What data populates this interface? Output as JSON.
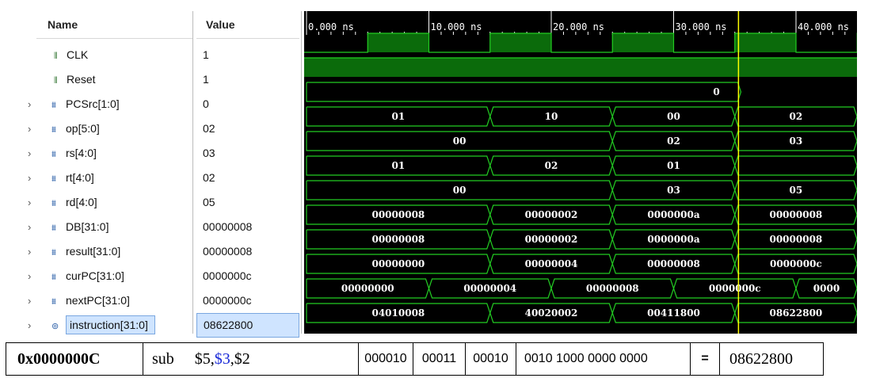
{
  "columns": {
    "name": "Name",
    "value": "Value"
  },
  "time_ticks": [
    "0.000 ns",
    "10.000 ns",
    "20.000 ns",
    "30.000 ns",
    "40.000 ns"
  ],
  "signals": [
    {
      "name": "CLK",
      "value": "1",
      "kind": "bit",
      "icon": "clock-signal-icon",
      "expandable": false
    },
    {
      "name": "Reset",
      "value": "1",
      "kind": "bit",
      "icon": "bit-signal-icon",
      "expandable": false
    },
    {
      "name": "PCSrc[1:0]",
      "value": "0",
      "kind": "bus",
      "icon": "bus-signal-icon",
      "expandable": true,
      "segments": [
        {
          "label": "",
          "t0": 0,
          "t1": 35.5
        }
      ],
      "note_label": "0"
    },
    {
      "name": "op[5:0]",
      "value": "02",
      "kind": "bus",
      "icon": "bus-signal-icon",
      "expandable": true,
      "segments": [
        {
          "label": "01",
          "t0": 0,
          "t1": 15
        },
        {
          "label": "10",
          "t0": 15,
          "t1": 25
        },
        {
          "label": "00",
          "t0": 25,
          "t1": 35
        },
        {
          "label": "02",
          "t0": 35,
          "t1": 45
        }
      ]
    },
    {
      "name": "rs[4:0]",
      "value": "03",
      "kind": "bus",
      "icon": "bus-signal-icon",
      "expandable": true,
      "segments": [
        {
          "label": "00",
          "t0": 0,
          "t1": 25
        },
        {
          "label": "02",
          "t0": 25,
          "t1": 35
        },
        {
          "label": "03",
          "t0": 35,
          "t1": 45
        }
      ]
    },
    {
      "name": "rt[4:0]",
      "value": "02",
      "kind": "bus",
      "icon": "bus-signal-icon",
      "expandable": true,
      "segments": [
        {
          "label": "01",
          "t0": 0,
          "t1": 15
        },
        {
          "label": "02",
          "t0": 15,
          "t1": 25
        },
        {
          "label": "01",
          "t0": 25,
          "t1": 35
        },
        {
          "label": "",
          "t0": 35,
          "t1": 45
        }
      ]
    },
    {
      "name": "rd[4:0]",
      "value": "05",
      "kind": "bus",
      "icon": "bus-signal-icon",
      "expandable": true,
      "segments": [
        {
          "label": "00",
          "t0": 0,
          "t1": 25
        },
        {
          "label": "03",
          "t0": 25,
          "t1": 35
        },
        {
          "label": "05",
          "t0": 35,
          "t1": 45
        }
      ]
    },
    {
      "name": "DB[31:0]",
      "value": "00000008",
      "kind": "bus",
      "icon": "bus-signal-icon",
      "expandable": true,
      "segments": [
        {
          "label": "00000008",
          "t0": 0,
          "t1": 15
        },
        {
          "label": "00000002",
          "t0": 15,
          "t1": 25
        },
        {
          "label": "0000000a",
          "t0": 25,
          "t1": 35
        },
        {
          "label": "00000008",
          "t0": 35,
          "t1": 45
        }
      ]
    },
    {
      "name": "result[31:0]",
      "value": "00000008",
      "kind": "bus",
      "icon": "bus-signal-icon",
      "expandable": true,
      "segments": [
        {
          "label": "00000008",
          "t0": 0,
          "t1": 15
        },
        {
          "label": "00000002",
          "t0": 15,
          "t1": 25
        },
        {
          "label": "0000000a",
          "t0": 25,
          "t1": 35
        },
        {
          "label": "00000008",
          "t0": 35,
          "t1": 45
        }
      ]
    },
    {
      "name": "curPC[31:0]",
      "value": "0000000c",
      "kind": "bus",
      "icon": "bus-signal-icon",
      "expandable": true,
      "segments": [
        {
          "label": "00000000",
          "t0": 0,
          "t1": 15
        },
        {
          "label": "00000004",
          "t0": 15,
          "t1": 25
        },
        {
          "label": "00000008",
          "t0": 25,
          "t1": 35
        },
        {
          "label": "0000000c",
          "t0": 35,
          "t1": 45
        }
      ]
    },
    {
      "name": "nextPC[31:0]",
      "value": "0000000c",
      "kind": "bus",
      "icon": "bus-signal-icon",
      "expandable": true,
      "segments": [
        {
          "label": "00000000",
          "t0": 0,
          "t1": 10
        },
        {
          "label": "00000004",
          "t0": 10,
          "t1": 20
        },
        {
          "label": "00000008",
          "t0": 20,
          "t1": 30
        },
        {
          "label": "0000000c",
          "t0": 30,
          "t1": 40
        },
        {
          "label": "0000",
          "t0": 40,
          "t1": 50
        }
      ]
    },
    {
      "name": "instruction[31:0]",
      "value": "08622800",
      "kind": "bus",
      "icon": "instruction-signal-icon",
      "expandable": true,
      "selected": true,
      "segments": [
        {
          "label": "04010008",
          "t0": 0,
          "t1": 15
        },
        {
          "label": "40020002",
          "t0": 15,
          "t1": 25
        },
        {
          "label": "00411800",
          "t0": 25,
          "t1": 35
        },
        {
          "label": "08622800",
          "t0": 35,
          "t1": 45
        }
      ]
    }
  ],
  "clk": {
    "period_ns": 10,
    "high_start_ns": 5,
    "high_duration_ns": 5
  },
  "cursor_ns": 35.3,
  "colors": {
    "wave": "#22cc22",
    "wave_fill": "#0b6b0b",
    "cursor": "#ffff00",
    "background": "#000000"
  },
  "instruction_row": {
    "address": "0x0000000C",
    "mnemonic": "sub",
    "operand_rd": "$5,",
    "operand_rs": "$3",
    "operand_rt": ",$2",
    "op_bits": "000010",
    "rs_bits": "00011",
    "rt_bits": "00010",
    "rest_bits": "0010 1000 0000 0000",
    "equals": "=",
    "hex": "08622800"
  }
}
